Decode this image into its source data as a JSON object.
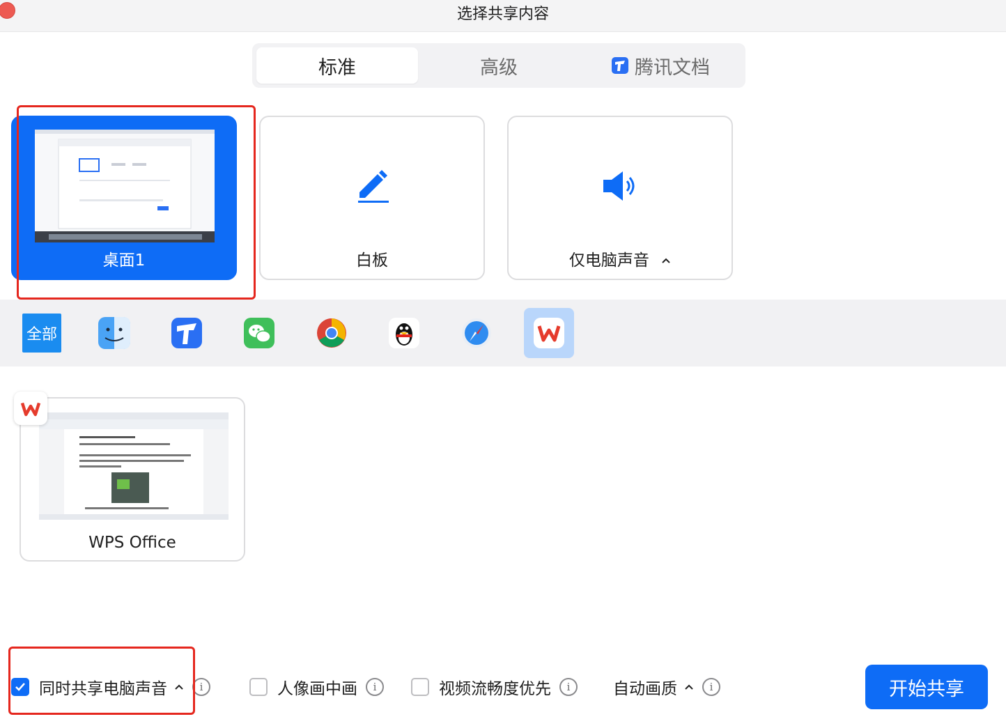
{
  "window": {
    "title": "选择共享内容"
  },
  "tabs": [
    {
      "label": "标准",
      "active": true
    },
    {
      "label": "高级",
      "active": false
    },
    {
      "label": "腾讯文档",
      "active": false,
      "icon": "tencent-docs-icon"
    }
  ],
  "share_cards": [
    {
      "label": "桌面1",
      "selected": true
    },
    {
      "label": "白板",
      "icon": "pencil-icon"
    },
    {
      "label": "仅电脑声音",
      "icon": "speaker-icon"
    }
  ],
  "app_filters": [
    {
      "label": "全部"
    },
    {
      "icon": "finder-icon"
    },
    {
      "icon": "tencent-docs-icon"
    },
    {
      "icon": "wechat-icon"
    },
    {
      "icon": "chrome-icon"
    },
    {
      "icon": "qq-icon"
    },
    {
      "icon": "safari-icon"
    },
    {
      "icon": "wps-icon",
      "selected": true
    }
  ],
  "windows": [
    {
      "label": "WPS Office",
      "icon": "wps-icon"
    }
  ],
  "options": {
    "share_audio": {
      "label": "同时共享电脑声音",
      "checked": true
    },
    "pip": {
      "label": "人像画中画",
      "checked": false
    },
    "fluency": {
      "label": "视频流畅度优先",
      "checked": false
    },
    "quality": {
      "label": "自动画质"
    }
  },
  "start_button": {
    "label": "开始共享"
  },
  "colors": {
    "accent": "#0e6cf6",
    "annotation": "#e5271e"
  }
}
